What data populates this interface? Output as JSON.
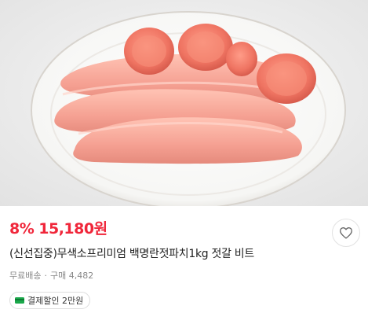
{
  "product": {
    "discount": "8%",
    "price": "15,180원",
    "title": "(신선집중)무색소프리미엄 백명란젓파치1kg 젓갈 비트",
    "shipping": "무료배송",
    "separator": "·",
    "purchase_count": "구매 4,482",
    "badge": "결제할인 2만원"
  },
  "icons": {
    "like": "heart-outline-icon",
    "badge": "card-icon"
  },
  "colors": {
    "price": "#f0263a",
    "badge_icon": "#1aa84a"
  }
}
